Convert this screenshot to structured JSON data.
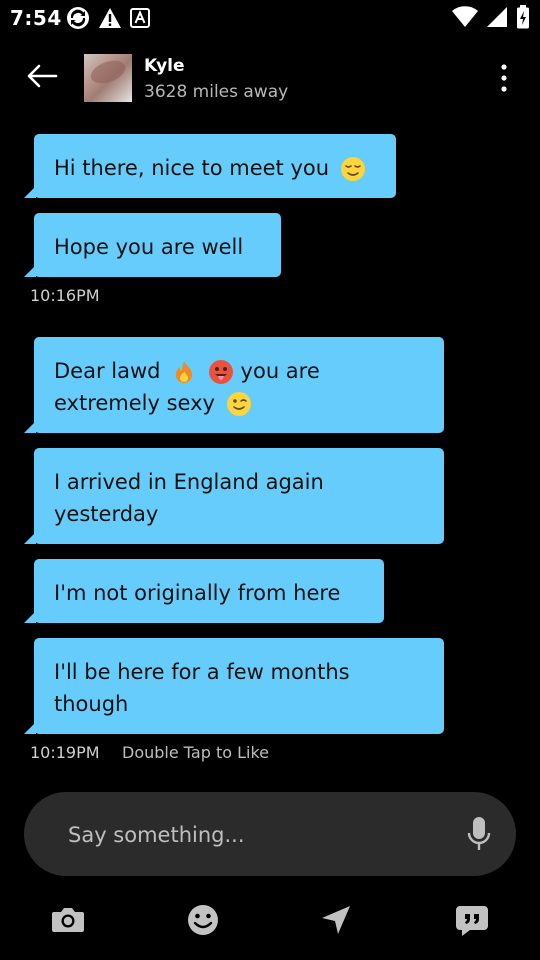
{
  "status_bar": {
    "time": "7:54",
    "left_icons": [
      "sync-icon",
      "warning-icon",
      "a-box-icon"
    ],
    "right_icons": [
      "wifi-icon",
      "signal-icon",
      "battery-icon"
    ]
  },
  "header": {
    "contact_name": "Kyle",
    "distance": "3628 miles away"
  },
  "messages": [
    {
      "text": "Hi there, nice to meet you",
      "emojis": [
        "relieved-emoji"
      ]
    },
    {
      "text": "Hope you are well",
      "emojis": []
    },
    {
      "text_a": "Dear lawd",
      "text_b": "you are",
      "text_c": "extremely sexy",
      "emojis": [
        "fire-emoji",
        "hot-face-emoji",
        "winking-emoji"
      ]
    },
    {
      "text": "I arrived in England again yesterday",
      "line1": "I arrived in England again",
      "line2": "yesterday"
    },
    {
      "text": "I'm not originally from here"
    },
    {
      "text": "I'll be here for a few months though",
      "line1": "I'll be here for a few months",
      "line2": "though"
    }
  ],
  "timestamps": {
    "first": "10:16PM",
    "second": "10:19PM",
    "double_tap_hint": "Double Tap to Like"
  },
  "composer": {
    "placeholder": "Say something..."
  },
  "toolbar": {
    "items": [
      "camera-icon",
      "emoji-icon",
      "location-icon",
      "saved-phrases-icon"
    ]
  },
  "colors": {
    "bubble": "#66ccfb",
    "background": "#000000",
    "composer": "#2b2b2b"
  }
}
